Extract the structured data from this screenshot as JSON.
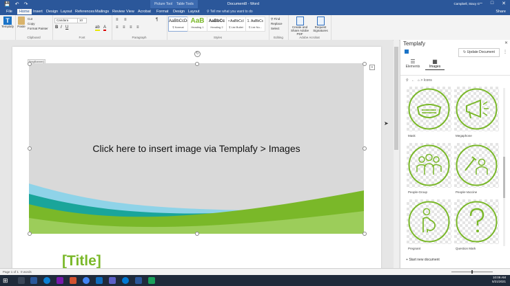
{
  "titlebar": {
    "context_tabs": [
      "Picture Tools",
      "Table Tools"
    ],
    "doc_title": "Document8 - Word",
    "account": "Campbell, Stacy G",
    "qat_icons": [
      "save-icon",
      "undo-icon",
      "redo-icon"
    ],
    "window_icons": [
      "minimize-icon",
      "maximize-icon",
      "close-icon"
    ]
  },
  "tabs": {
    "items": [
      "File",
      "Home",
      "Insert",
      "Design",
      "Layout",
      "References",
      "Mailings",
      "Review",
      "View",
      "Acrobat",
      "Format",
      "Design",
      "Layout"
    ],
    "active_index": 1,
    "tell_me": "Tell me what you want to do",
    "share": "Share"
  },
  "ribbon": {
    "templafy_label": "Templafy",
    "paste_label": "Paste",
    "clipboard_items": [
      "Cut",
      "Copy",
      "Format Painter"
    ],
    "clipboard_group": "Clipboard",
    "font_name": "Candara",
    "font_size": "10",
    "font_group": "Font",
    "paragraph_group": "Paragraph",
    "styles": [
      {
        "sample": "AaBbCcDd",
        "name": "¶ Normal"
      },
      {
        "sample": "AaB",
        "name": "Heading 1"
      },
      {
        "sample": "AaBbCc",
        "name": "Heading 2"
      },
      {
        "sample": "• AaBbCcI",
        "name": "¶ List Bullet"
      },
      {
        "sample": "1. AaBbCc",
        "name": "¶ List Nu..."
      }
    ],
    "styles_group": "Styles",
    "editing_items": [
      "Find",
      "Replace",
      "Select"
    ],
    "editing_group": "Editing",
    "adobe_items": [
      "Create and Share Adobe PDF",
      "Request Signatures"
    ],
    "adobe_group": "Adobe Acrobat"
  },
  "document": {
    "image_tag": "[ImgBanner]",
    "placeholder_text": "Click here to insert image via Templafy > Images",
    "title_placeholder": "[Title]"
  },
  "pane": {
    "title": "Templafy",
    "update_button": "Update Document",
    "tabs": [
      "Elements",
      "Images"
    ],
    "active_tab": "Images",
    "breadcrumb": "Icons",
    "tiles": [
      {
        "label": "Mask",
        "icon": "mask-icon"
      },
      {
        "label": "Megaphone",
        "icon": "megaphone-icon"
      },
      {
        "label": "People-Group",
        "icon": "people-group-icon"
      },
      {
        "label": "People-Vaccine",
        "icon": "people-vaccine-icon"
      },
      {
        "label": "Pregnant",
        "icon": "pregnant-icon"
      },
      {
        "label": "Question Mark",
        "icon": "question-mark-icon"
      }
    ],
    "start_new": "Start new document"
  },
  "statusbar": {
    "page": "Page 1 of 1",
    "words": "0 words"
  },
  "taskbar": {
    "time": "10:09 AM",
    "date": "5/21/2021"
  },
  "colors": {
    "word_blue": "#2b579a",
    "templafy_green": "#7ab829",
    "teal": "#1aa59a",
    "light_blue": "#8fd3e8"
  }
}
